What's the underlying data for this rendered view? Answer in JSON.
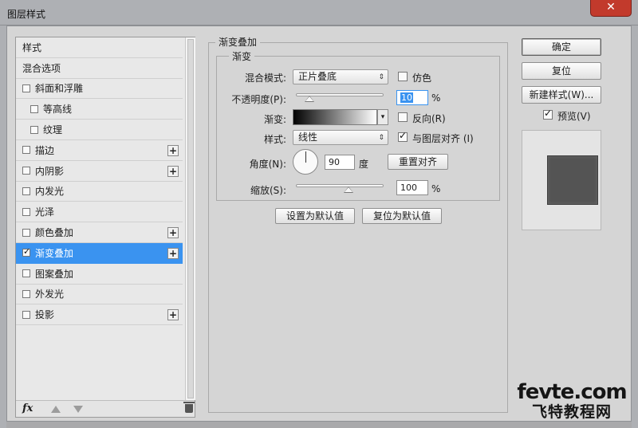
{
  "window": {
    "title": "图层样式",
    "close_label": "✕"
  },
  "left_panel": {
    "items": [
      {
        "label": "样式",
        "checkbox": false,
        "checked": false,
        "plus": false,
        "sub": false,
        "selected": false
      },
      {
        "label": "混合选项",
        "checkbox": false,
        "checked": false,
        "plus": false,
        "sub": false,
        "selected": false
      },
      {
        "label": "斜面和浮雕",
        "checkbox": true,
        "checked": false,
        "plus": false,
        "sub": false,
        "selected": false
      },
      {
        "label": "等高线",
        "checkbox": true,
        "checked": false,
        "plus": false,
        "sub": true,
        "selected": false
      },
      {
        "label": "纹理",
        "checkbox": true,
        "checked": false,
        "plus": false,
        "sub": true,
        "selected": false
      },
      {
        "label": "描边",
        "checkbox": true,
        "checked": false,
        "plus": true,
        "sub": false,
        "selected": false
      },
      {
        "label": "内阴影",
        "checkbox": true,
        "checked": false,
        "plus": true,
        "sub": false,
        "selected": false
      },
      {
        "label": "内发光",
        "checkbox": true,
        "checked": false,
        "plus": false,
        "sub": false,
        "selected": false
      },
      {
        "label": "光泽",
        "checkbox": true,
        "checked": false,
        "plus": false,
        "sub": false,
        "selected": false
      },
      {
        "label": "颜色叠加",
        "checkbox": true,
        "checked": false,
        "plus": true,
        "sub": false,
        "selected": false
      },
      {
        "label": "渐变叠加",
        "checkbox": true,
        "checked": true,
        "plus": true,
        "sub": false,
        "selected": true
      },
      {
        "label": "图案叠加",
        "checkbox": true,
        "checked": false,
        "plus": false,
        "sub": false,
        "selected": false
      },
      {
        "label": "外发光",
        "checkbox": true,
        "checked": false,
        "plus": false,
        "sub": false,
        "selected": false
      },
      {
        "label": "投影",
        "checkbox": true,
        "checked": false,
        "plus": true,
        "sub": false,
        "selected": false
      }
    ],
    "footer": {
      "fx_label": "fx"
    }
  },
  "gradient_overlay": {
    "group_title": "渐变叠加",
    "subgroup_title": "渐变",
    "blend_mode": {
      "label": "混合模式:",
      "value": "正片叠底"
    },
    "dither": {
      "label": "仿色",
      "checked": false
    },
    "opacity": {
      "label": "不透明度(P):",
      "value": "10",
      "unit": "%",
      "level": 0.1
    },
    "gradient": {
      "label": "渐变:"
    },
    "reverse": {
      "label": "反向(R)",
      "checked": false
    },
    "style": {
      "label": "样式:",
      "value": "线性"
    },
    "align_layer": {
      "label": "与图层对齐 (I)",
      "checked": true
    },
    "angle": {
      "label": "角度(N):",
      "value": "90",
      "unit": "度"
    },
    "reset_align_label": "重置对齐",
    "scale": {
      "label": "缩放(S):",
      "value": "100",
      "unit": "%",
      "level": 1.0
    },
    "set_default_label": "设置为默认值",
    "reset_default_label": "复位为默认值"
  },
  "right_panel": {
    "ok_label": "确定",
    "reset_label": "复位",
    "new_style_label": "新建样式(W)...",
    "preview": {
      "label": "预览(V)",
      "checked": true
    }
  },
  "watermark": {
    "line1": "fevte.com",
    "line2": "飞特教程网"
  },
  "colors": {
    "selection": "#3a93f0",
    "close": "#c23a2c",
    "swatch": "#545454"
  }
}
